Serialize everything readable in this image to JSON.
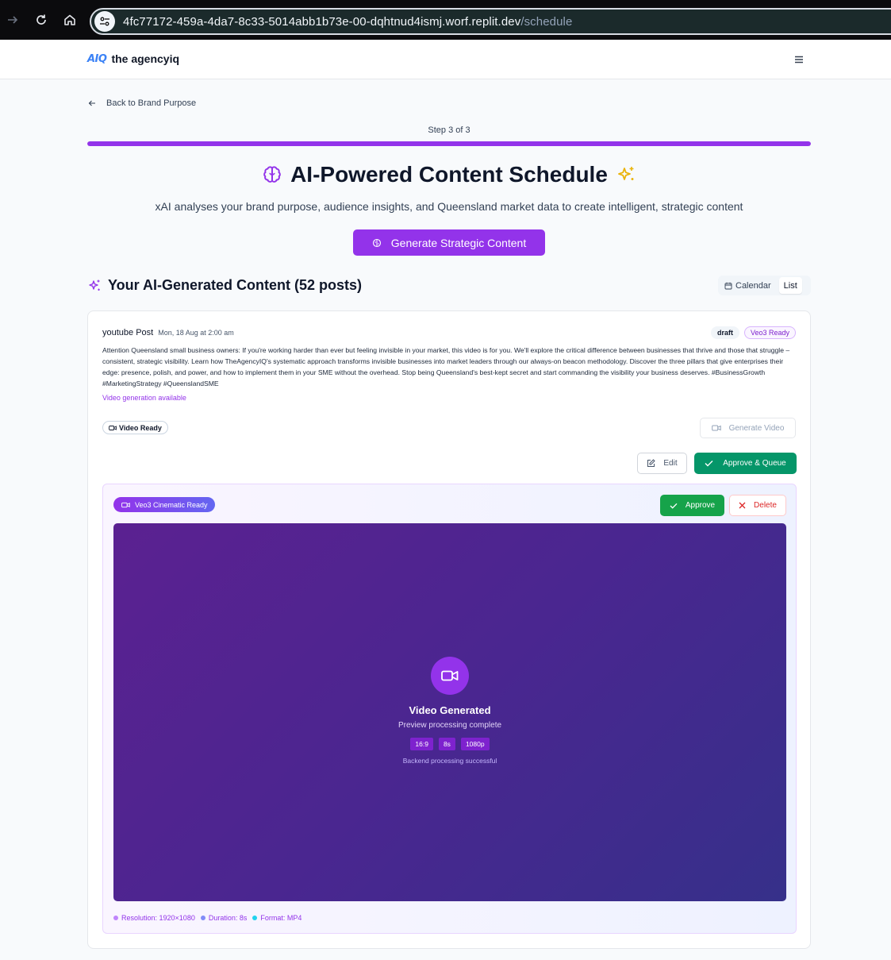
{
  "browser": {
    "url_host": "4fc77172-459a-4da7-8c33-5014abb1b73e-00-dqhtnud4ismj.worf.replit.dev",
    "url_path": "/schedule"
  },
  "header": {
    "logo_mark": "AIQ",
    "brand_name": "the agencyiq"
  },
  "nav": {
    "back_label": "Back to Brand Purpose",
    "step_label": "Step 3 of 3",
    "progress": 1.0
  },
  "hero": {
    "title": "AI-Powered Content Schedule",
    "subtitle": "xAI analyses your brand purpose, audience insights, and Queensland market data to create intelligent, strategic content",
    "generate_button": "Generate Strategic Content"
  },
  "content_section": {
    "title": "Your AI-Generated Content (52 posts)",
    "view_options": [
      "Calendar",
      "List"
    ],
    "active_view": "List"
  },
  "post": {
    "platform_label": "youtube Post",
    "date": "Mon, 18 Aug at 2:00 am",
    "status_badge": "draft",
    "veo_badge": "Veo3 Ready",
    "text": "Attention Queensland small business owners: If you're working harder than ever but feeling invisible in your market, this video is for you. We'll explore the critical difference between businesses that thrive and those that struggle – consistent, strategic visibility. Learn how TheAgencyIQ's systematic approach transforms invisible businesses into market leaders through our always-on beacon methodology. Discover the three pillars that give enterprises their edge: presence, polish, and power, and how to implement them in your SME without the overhead. Stop being Queensland's best-kept secret and start commanding the visibility your business deserves. #BusinessGrowth #MarketingStrategy #QueenslandSME",
    "video_available": "Video generation available",
    "video_ready_chip": "Video Ready",
    "generate_video_button": "Generate Video",
    "edit_button": "Edit",
    "approve_queue_button": "Approve & Queue"
  },
  "video_panel": {
    "pill": "Veo3 Cinematic Ready",
    "approve_button": "Approve",
    "delete_button": "Delete",
    "title": "Video Generated",
    "subtitle": "Preview processing complete",
    "tags": [
      "16:9",
      "8s",
      "1080p"
    ],
    "note": "Backend processing successful",
    "meta": [
      {
        "label": "Resolution: 1920×1080",
        "color": "#c084fc"
      },
      {
        "label": "Duration: 8s",
        "color": "#818cf8"
      },
      {
        "label": "Format: MP4",
        "color": "#22d3ee"
      }
    ]
  },
  "colors": {
    "accent": "#9333ea",
    "approve_green": "#059669",
    "delete_red": "#dc2626"
  }
}
